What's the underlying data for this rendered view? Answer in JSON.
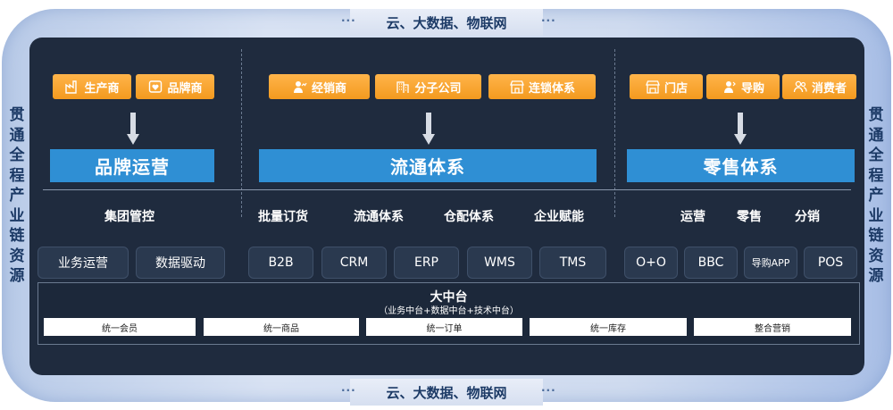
{
  "banner": {
    "top": "云、大数据、物联网",
    "bottom": "云、大数据、物联网",
    "dots": "···"
  },
  "side": {
    "left": "贯通全程产业链资源",
    "right": "贯通全程产业链资源"
  },
  "chips": [
    {
      "label": "生产商",
      "icon": "factory-icon"
    },
    {
      "label": "品牌商",
      "icon": "heart-shield-icon"
    },
    {
      "label": "经销商",
      "icon": "person-chart-icon"
    },
    {
      "label": "分子公司",
      "icon": "building-icon"
    },
    {
      "label": "连锁体系",
      "icon": "storefront-icon"
    },
    {
      "label": "门店",
      "icon": "store-icon"
    },
    {
      "label": "导购",
      "icon": "guide-person-icon"
    },
    {
      "label": "消费者",
      "icon": "users-icon"
    }
  ],
  "heads": [
    "品牌运营",
    "流通体系",
    "零售体系"
  ],
  "functions": [
    "集团管控",
    "批量订货",
    "流通体系",
    "仓配体系",
    "企业赋能",
    "运营",
    "零售",
    "分销"
  ],
  "systems": [
    "业务运营",
    "数据驱动",
    "B2B",
    "CRM",
    "ERP",
    "WMS",
    "TMS",
    "O+O",
    "BBC",
    "导购APP",
    "POS"
  ],
  "platform": {
    "title": "大中台",
    "subtitle": "（业务中台+数据中台+技术中台）",
    "capabilities": [
      "统一会员",
      "统一商品",
      "统一订单",
      "统一库存",
      "整合营销"
    ]
  },
  "colors": {
    "accent_orange": "#f7a531",
    "bar_blue": "#2f8fd4",
    "panel_dark": "#1f2b3e",
    "ring_light": "#cfdbef"
  }
}
